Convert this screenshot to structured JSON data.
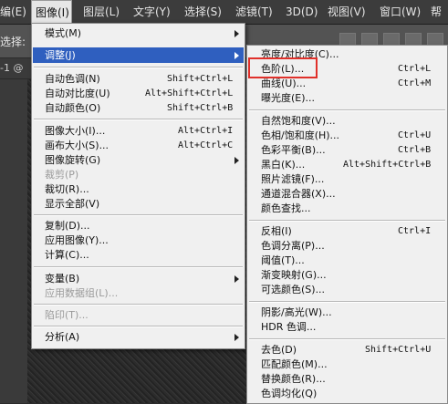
{
  "menubar": {
    "items": [
      {
        "label": "编(E)"
      },
      {
        "label": "图像(I)"
      },
      {
        "label": "图层(L)"
      },
      {
        "label": "文字(Y)"
      },
      {
        "label": "选择(S)"
      },
      {
        "label": "滤镜(T)"
      },
      {
        "label": "3D(D)"
      },
      {
        "label": "视图(V)"
      },
      {
        "label": "窗口(W)"
      },
      {
        "label": "帮"
      }
    ]
  },
  "optbar": {
    "label": "选择:"
  },
  "doc_tab": {
    "label": "-1 @"
  },
  "image_menu": {
    "items": [
      {
        "label": "模式(M)",
        "shortcut": ""
      },
      {
        "label": "调整(J)",
        "shortcut": ""
      },
      {
        "label": "自动色调(N)",
        "shortcut": "Shift+Ctrl+L"
      },
      {
        "label": "自动对比度(U)",
        "shortcut": "Alt+Shift+Ctrl+L"
      },
      {
        "label": "自动颜色(O)",
        "shortcut": "Shift+Ctrl+B"
      },
      {
        "label": "图像大小(I)...",
        "shortcut": "Alt+Ctrl+I"
      },
      {
        "label": "画布大小(S)...",
        "shortcut": "Alt+Ctrl+C"
      },
      {
        "label": "图像旋转(G)",
        "shortcut": ""
      },
      {
        "label": "裁剪(P)",
        "shortcut": ""
      },
      {
        "label": "裁切(R)...",
        "shortcut": ""
      },
      {
        "label": "显示全部(V)",
        "shortcut": ""
      },
      {
        "label": "复制(D)...",
        "shortcut": ""
      },
      {
        "label": "应用图像(Y)...",
        "shortcut": ""
      },
      {
        "label": "计算(C)...",
        "shortcut": ""
      },
      {
        "label": "变量(B)",
        "shortcut": ""
      },
      {
        "label": "应用数据组(L)...",
        "shortcut": ""
      },
      {
        "label": "陷印(T)...",
        "shortcut": ""
      },
      {
        "label": "分析(A)",
        "shortcut": ""
      }
    ]
  },
  "adjust_menu": {
    "items": [
      {
        "label": "亮度/对比度(C)...",
        "shortcut": ""
      },
      {
        "label": "色阶(L)...",
        "shortcut": "Ctrl+L"
      },
      {
        "label": "曲线(U)...",
        "shortcut": "Ctrl+M"
      },
      {
        "label": "曝光度(E)...",
        "shortcut": ""
      },
      {
        "label": "自然饱和度(V)...",
        "shortcut": ""
      },
      {
        "label": "色相/饱和度(H)...",
        "shortcut": "Ctrl+U"
      },
      {
        "label": "色彩平衡(B)...",
        "shortcut": "Ctrl+B"
      },
      {
        "label": "黑白(K)...",
        "shortcut": "Alt+Shift+Ctrl+B"
      },
      {
        "label": "照片滤镜(F)...",
        "shortcut": ""
      },
      {
        "label": "通道混合器(X)...",
        "shortcut": ""
      },
      {
        "label": "颜色查找...",
        "shortcut": ""
      },
      {
        "label": "反相(I)",
        "shortcut": "Ctrl+I"
      },
      {
        "label": "色调分离(P)...",
        "shortcut": ""
      },
      {
        "label": "阈值(T)...",
        "shortcut": ""
      },
      {
        "label": "渐变映射(G)...",
        "shortcut": ""
      },
      {
        "label": "可选颜色(S)...",
        "shortcut": ""
      },
      {
        "label": "阴影/高光(W)...",
        "shortcut": ""
      },
      {
        "label": "HDR 色调...",
        "shortcut": ""
      },
      {
        "label": "去色(D)",
        "shortcut": "Shift+Ctrl+U"
      },
      {
        "label": "匹配颜色(M)...",
        "shortcut": ""
      },
      {
        "label": "替换颜色(R)...",
        "shortcut": ""
      },
      {
        "label": "色调均化(Q)",
        "shortcut": ""
      }
    ]
  },
  "colors": {
    "highlight": "#2f5fbf",
    "annotation": "#e0302a"
  }
}
